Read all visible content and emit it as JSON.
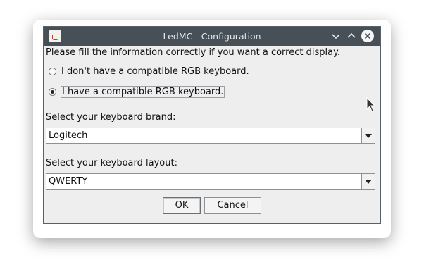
{
  "window": {
    "title": "LedMC - Configuration",
    "icon": "java-cup-icon",
    "controls": {
      "minimize": "chevron-down-icon",
      "maximize": "chevron-up-icon",
      "close": "close-icon"
    }
  },
  "form": {
    "info_text": "Please fill the information correctly if you want a correct display.",
    "radios": [
      {
        "label": "I don't have a compatible RGB keyboard.",
        "checked": false
      },
      {
        "label": "I have a compatible RGB keyboard.",
        "checked": true
      }
    ],
    "brand": {
      "label": "Select your keyboard brand:",
      "value": "Logitech"
    },
    "layout": {
      "label": "Select your keyboard layout:",
      "value": "QWERTY"
    }
  },
  "buttons": {
    "ok": "OK",
    "cancel": "Cancel"
  },
  "colors": {
    "titlebar": "#475057",
    "window_bg": "#eeeeee"
  }
}
